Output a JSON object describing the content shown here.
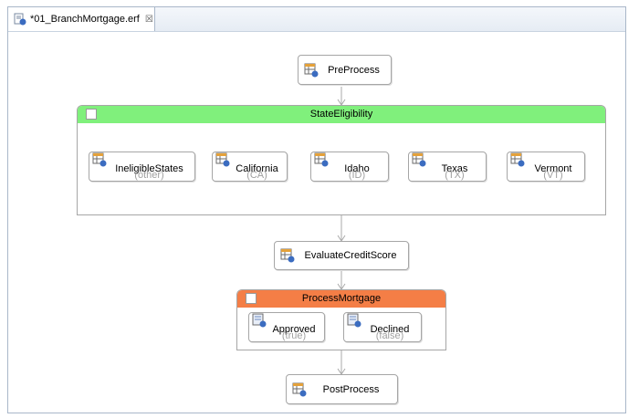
{
  "tab": {
    "title": "*01_BranchMortgage.erf",
    "close_glyph": "☒"
  },
  "colors": {
    "state_header": "#80f07c",
    "process_header": "#f47e46",
    "connector": "#a9a9a9"
  },
  "diagram": {
    "preprocess": {
      "label": "PreProcess"
    },
    "state_group": {
      "title": "StateEligibility",
      "items": [
        {
          "label": "IneligibleStates",
          "sub": "(other)"
        },
        {
          "label": "California",
          "sub": "(CA)"
        },
        {
          "label": "Idaho",
          "sub": "(ID)"
        },
        {
          "label": "Texas",
          "sub": "(TX)"
        },
        {
          "label": "Vermont",
          "sub": "(VT)"
        }
      ]
    },
    "evaluate": {
      "label": "EvaluateCreditScore"
    },
    "process_group": {
      "title": "ProcessMortgage",
      "items": [
        {
          "label": "Approved",
          "sub": "(true)"
        },
        {
          "label": "Declined",
          "sub": "(false)"
        }
      ]
    },
    "postprocess": {
      "label": "PostProcess"
    }
  }
}
